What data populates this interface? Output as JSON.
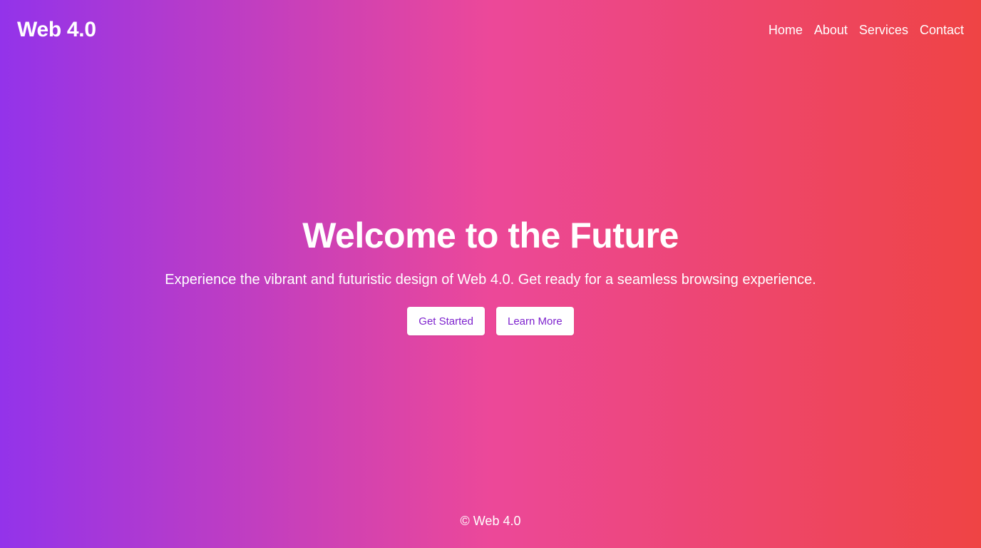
{
  "header": {
    "logo": "Web 4.0",
    "nav": [
      {
        "label": "Home"
      },
      {
        "label": "About"
      },
      {
        "label": "Services"
      },
      {
        "label": "Contact"
      }
    ]
  },
  "hero": {
    "title": "Welcome to the Future",
    "subtitle": "Experience the vibrant and futuristic design of Web 4.0. Get ready for a seamless browsing experience.",
    "buttons": {
      "primary": "Get Started",
      "secondary": "Learn More"
    }
  },
  "footer": {
    "text": "© Web 4.0"
  },
  "colors": {
    "gradient_start": "#9333ea",
    "gradient_mid": "#ec4899",
    "gradient_end": "#ef4444",
    "button_text": "#7e22ce",
    "button_bg": "#ffffff"
  }
}
